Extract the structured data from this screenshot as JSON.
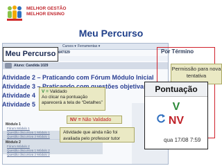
{
  "logo": {
    "line1": "MELHOR GESTÃO",
    "line2": "MELHOR ENSINO",
    "mark_colors": [
      "#8bc34a",
      "#f2a900",
      "#2f6fbf",
      "#d02a2a"
    ]
  },
  "title": "Meu Percurso",
  "browser": {
    "menu": [
      "Cursos ▾",
      "Ferramentas ▾"
    ],
    "course_code": "MAT029",
    "student_label": "Aluno: Candida 1029"
  },
  "callouts": {
    "meu_percurso": "Meu Percurso",
    "column_header": "Por Término",
    "permissao": "Permissão para nova tentativa",
    "pontuacao_header": "Pontuação",
    "pontuacao_v": "V",
    "pontuacao_nv": "NV",
    "legend_v_key": "V = ",
    "legend_v_value": "Validado",
    "legend_v_text": "Ao clicar na pontuação aparecerá a tela de “Detalhes”",
    "legend_nv_key": "NV = ",
    "legend_nv_value": "Não Validado",
    "legend_atividade": "Atividade que ainda não foi avaliada pelo professor tutor"
  },
  "activities": [
    "Atividade 2 – Praticando com Fórum Módulo Inicial",
    "Atividade 3 – Praticando com questões objetivas M",
    "Atividade 4",
    "Atividade 5"
  ],
  "modules": {
    "module1_title": "Módulo 1",
    "module2_title": "Módulo 2",
    "items": [
      "Fórum Módulo 1",
      "Questão discursiva 1 Módulo 1",
      "Questão discursiva 2 Módulo 1",
      "Fórum Módulo 2",
      "Questão discursiva 1 Módulo 2",
      "Questão discursiva 2 Módulo 2"
    ]
  },
  "date_text": "qua 17/08 7:59",
  "colors": {
    "title": "#1f3f8a",
    "validado": "#2d8a3a",
    "nao_validado": "#c0232a",
    "callout_bg": "#eae9c4",
    "highlight_border": "#d0202a"
  }
}
